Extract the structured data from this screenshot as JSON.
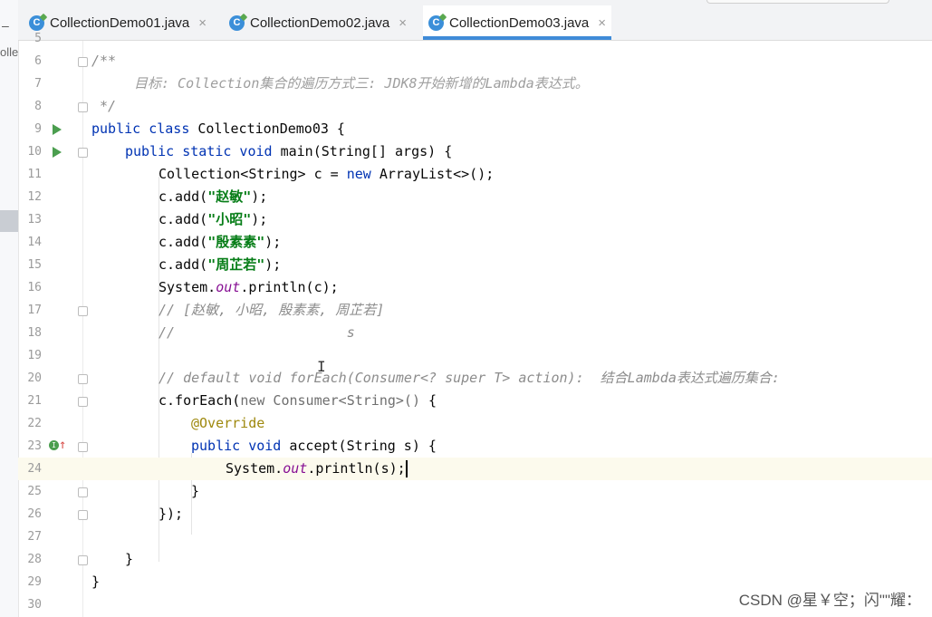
{
  "left_panel": {
    "collapse_glyph": "–",
    "truncated_label": "olle"
  },
  "tabs": [
    {
      "label": "CollectionDemo01.java",
      "icon": "C",
      "close": "×",
      "active": false
    },
    {
      "label": "CollectionDemo02.java",
      "icon": "C",
      "close": "×",
      "active": false
    },
    {
      "label": "CollectionDemo03.java",
      "icon": "C",
      "close": "×",
      "active": true
    }
  ],
  "editor": {
    "line_numbers": [
      "5",
      "6",
      "7",
      "8",
      "9",
      "10",
      "11",
      "12",
      "13",
      "14",
      "15",
      "16",
      "17",
      "18",
      "19",
      "20",
      "21",
      "22",
      "23",
      "24",
      "25",
      "26",
      "27",
      "28",
      "29",
      "30"
    ],
    "code": {
      "l6": "/**",
      "l7": "目标: Collection集合的遍历方式三: JDK8开始新增的Lambda表达式。",
      "l8": " */",
      "l9_kw": "public class",
      "l9_rest": " CollectionDemo03 {",
      "l10_kw": "public static void",
      "l10_rest": " main(String[] args) {",
      "l11_a": "Collection<String> c = ",
      "l11_kw": "new",
      "l11_b": " ArrayList<>();",
      "l12_a": "c.add(",
      "l12_s": "\"赵敏\"",
      "l12_b": ");",
      "l13_a": "c.add(",
      "l13_s": "\"小昭\"",
      "l13_b": ");",
      "l14_a": "c.add(",
      "l14_s": "\"殷素素\"",
      "l14_b": ");",
      "l15_a": "c.add(",
      "l15_s": "\"周芷若\"",
      "l15_b": ");",
      "l16_a": "System.",
      "l16_f": "out",
      "l16_b": ".println(c);",
      "l17": "// [赵敏, 小昭, 殷素素, 周芷若]",
      "l18": "//                     s",
      "l20": "// default void forEach(Consumer<? super T> action):  结合Lambda表达式遍历集合:",
      "l21_a": "c.forEach(",
      "l21_g": "new Consumer<String>()",
      "l21_b": " {",
      "l22": "@Override",
      "l23_kw": "public void",
      "l23_rest": " accept(String s) {",
      "l24_a": "System.",
      "l24_f": "out",
      "l24_b": ".println(s);",
      "l25": "}",
      "l26": "});",
      "l28": "}",
      "l29": "}"
    }
  },
  "watermark": "CSDN @星￥空；闪\"\"耀：",
  "colors": {
    "keyword": "#0033b3",
    "string": "#067d17",
    "comment": "#8c8c8c",
    "field": "#871094",
    "annotation": "#9e880d",
    "tab_active_underline": "#3f8bd8"
  }
}
